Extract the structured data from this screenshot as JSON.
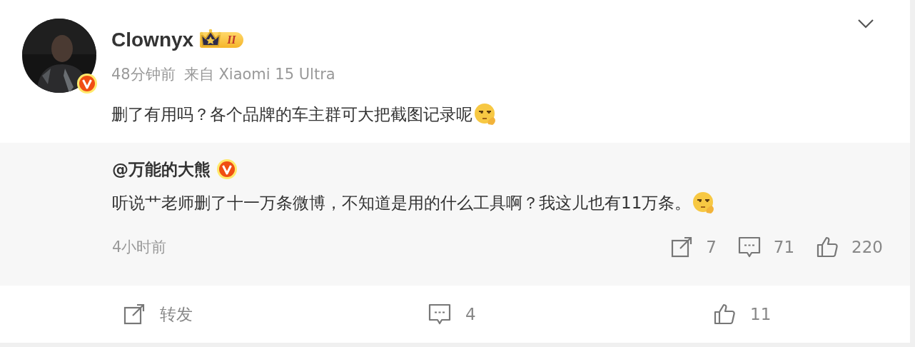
{
  "post": {
    "author": "Clownyx",
    "member_level": "II",
    "verified": true,
    "time": "48分钟前",
    "source": "来自 Xiaomi 15 Ultra",
    "text": "删了有用吗？各个品牌的车主群可大把截图记录呢",
    "emoji": true
  },
  "quoted": {
    "author": "@万能的大熊",
    "verified": true,
    "text": "听说艹老师删了十一万条微博，不知道是用的什么工具啊？我这儿也有11万条。",
    "emoji": true,
    "time": "4小时前",
    "actions": [
      {
        "kind": "repost",
        "count": "7"
      },
      {
        "kind": "comment",
        "count": "71"
      },
      {
        "kind": "like",
        "count": "220"
      }
    ]
  },
  "actions": [
    {
      "kind": "repost",
      "label": "转发"
    },
    {
      "kind": "comment",
      "label": "4"
    },
    {
      "kind": "like",
      "label": "11"
    }
  ]
}
